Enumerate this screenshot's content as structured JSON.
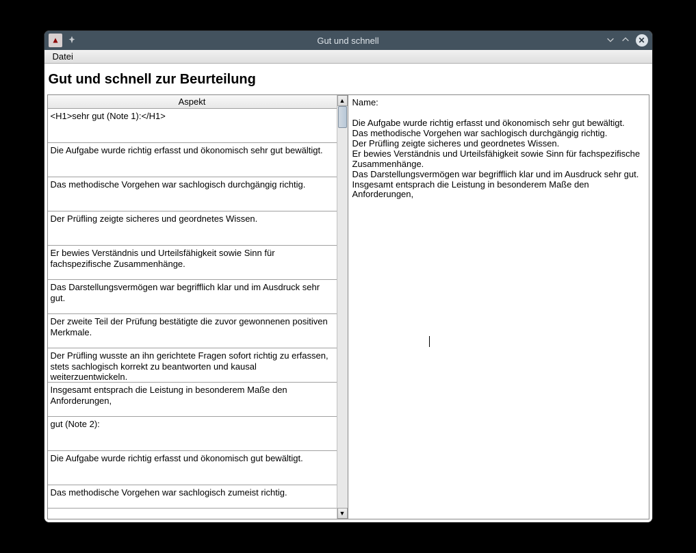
{
  "window": {
    "title": "Gut und schnell"
  },
  "menubar": {
    "file": "Datei"
  },
  "heading": "Gut und schnell zur Beurteilung",
  "table": {
    "header": "Aspekt",
    "rows": [
      "<H1>sehr gut (Note 1):</H1>",
      "Die Aufgabe wurde richtig erfasst und ökonomisch sehr gut bewältigt.",
      "Das methodische Vorgehen war sachlogisch durchgängig richtig.",
      "Der Prüfling zeigte sicheres und geordnetes Wissen.",
      "Er bewies Verständnis und Urteilsfähigkeit sowie Sinn für fachspezifische Zusammenhänge.",
      "Das Darstellungsvermögen war begrifflich klar und im Ausdruck sehr gut.",
      "Der zweite Teil der Prüfung bestätigte die zuvor gewonnenen positiven Merkmale.",
      "Der Prüfling wusste an ihn gerichtete Fragen sofort  richtig zu erfassen, stets sachlogisch korrekt zu beantworten und kausal weiterzuentwickeln.",
      "Insgesamt entsprach die Leistung in besonderem Maße den Anforderungen,",
      "gut (Note 2):",
      "Die Aufgabe wurde richtig erfasst und ökonomisch gut bewältigt.",
      "Das methodische Vorgehen war sachlogisch zumeist richtig."
    ]
  },
  "preview": {
    "name_label": "Name:",
    "lines": [
      "Die Aufgabe wurde richtig erfasst und ökonomisch sehr gut bewältigt.",
      "Das methodische Vorgehen war sachlogisch durchgängig richtig.",
      "Der Prüfling zeigte sicheres und geordnetes Wissen.",
      "Er bewies Verständnis und Urteilsfähigkeit sowie Sinn für fachspezifische Zusammenhänge.",
      "Das Darstellungsvermögen war begrifflich klar und im Ausdruck sehr gut.",
      "Insgesamt entsprach die Leistung in besonderem Maße den Anforderungen,"
    ]
  }
}
